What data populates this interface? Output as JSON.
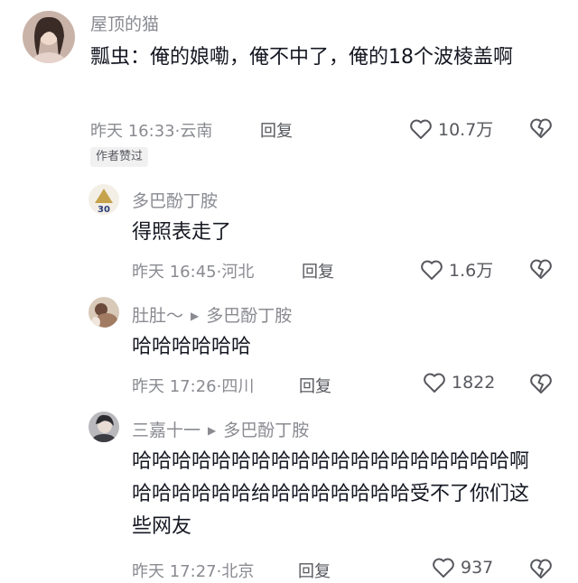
{
  "comments": [
    {
      "username": "屋顶的猫",
      "text": "瓢虫：俺的娘嘞，俺不中了，俺的18个波棱盖啊",
      "time": "昨天 16:33",
      "location": "云南",
      "reply_label": "回复",
      "likes": "10.7万",
      "badge": "作者赞过"
    },
    {
      "username": "多巴酚丁胺",
      "avatar_text": "30",
      "text": "得照表走了",
      "time": "昨天 16:45",
      "location": "河北",
      "reply_label": "回复",
      "likes": "1.6万"
    },
    {
      "username": "肚肚～",
      "reply_to": "多巴酚丁胺",
      "text": "哈哈哈哈哈哈",
      "time": "昨天 17:26",
      "location": "四川",
      "reply_label": "回复",
      "likes": "1822"
    },
    {
      "username": "三嘉十一",
      "reply_to": "多巴酚丁胺",
      "text": "哈哈哈哈哈哈哈哈哈哈哈哈哈哈哈哈哈哈哈啊哈哈哈哈哈哈给哈哈哈哈哈哈哈受不了你们这些网友",
      "time": "昨天 17:27",
      "location": "北京",
      "reply_label": "回复",
      "likes": "937"
    }
  ],
  "separator": "·",
  "icons": {
    "like": "heart-outline-icon",
    "dislike": "broken-heart-icon",
    "reply_arrow": "triangle-right-icon"
  }
}
